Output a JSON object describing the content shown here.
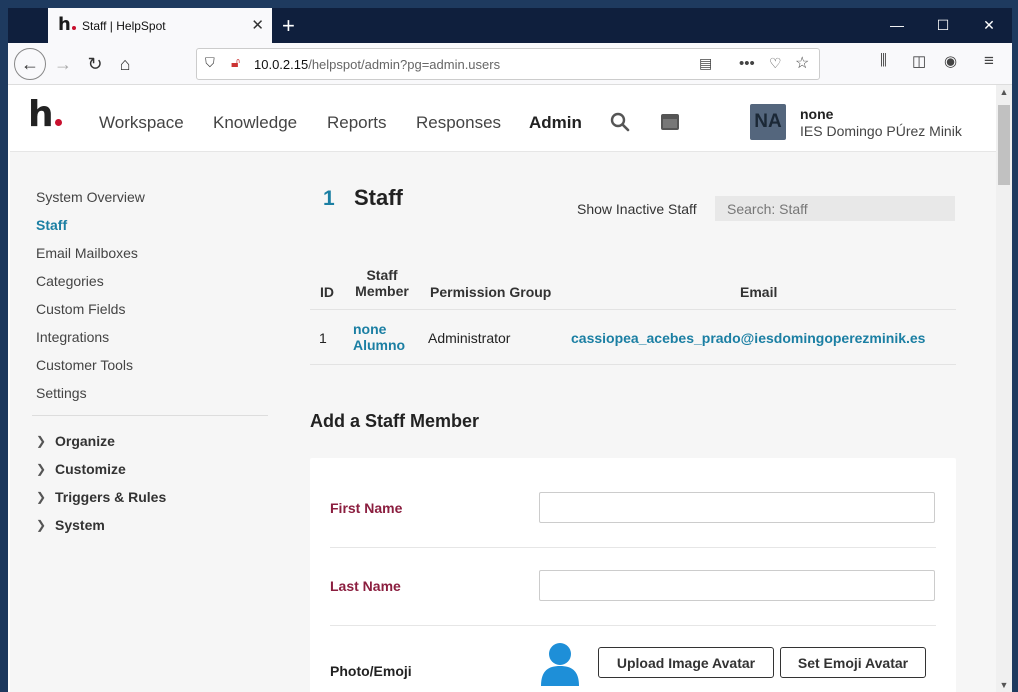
{
  "browser": {
    "tab_title": "Staff | HelpSpot",
    "url_host": "10.0.2.15",
    "url_path": "/helpspot/admin?pg=admin.users"
  },
  "topnav": {
    "items": [
      "Workspace",
      "Knowledge",
      "Reports",
      "Responses",
      "Admin"
    ],
    "active": "Admin"
  },
  "user": {
    "initials": "NA",
    "name": "none",
    "org": "IES Domingo PÚrez Minik"
  },
  "sidebar": {
    "items": [
      "System Overview",
      "Staff",
      "Email Mailboxes",
      "Categories",
      "Custom Fields",
      "Integrations",
      "Customer Tools",
      "Settings"
    ],
    "active": "Staff",
    "groups": [
      "Organize",
      "Customize",
      "Triggers & Rules",
      "System"
    ]
  },
  "staff": {
    "count": "1",
    "title": "Staff",
    "show_inactive": "Show Inactive Staff",
    "search_placeholder": "Search: Staff",
    "columns": {
      "id": "ID",
      "member_line1": "Staff",
      "member_line2": "Member",
      "group": "Permission Group",
      "email": "Email"
    },
    "rows": [
      {
        "id": "1",
        "first": "none",
        "last": "Alumno",
        "group": "Administrator",
        "email": "cassiopea_acebes_prado@iesdomingoperezminik.es"
      }
    ]
  },
  "add_form": {
    "title": "Add a Staff Member",
    "first_name_label": "First Name",
    "last_name_label": "Last Name",
    "photo_label": "Photo/Emoji",
    "upload_button": "Upload Image Avatar",
    "emoji_button": "Set Emoji Avatar"
  },
  "colors": {
    "accent": "#1b7fa3",
    "required_label": "#8b1e3f",
    "avatar_bg": "#54667d",
    "brand_dot": "#c8102e"
  }
}
